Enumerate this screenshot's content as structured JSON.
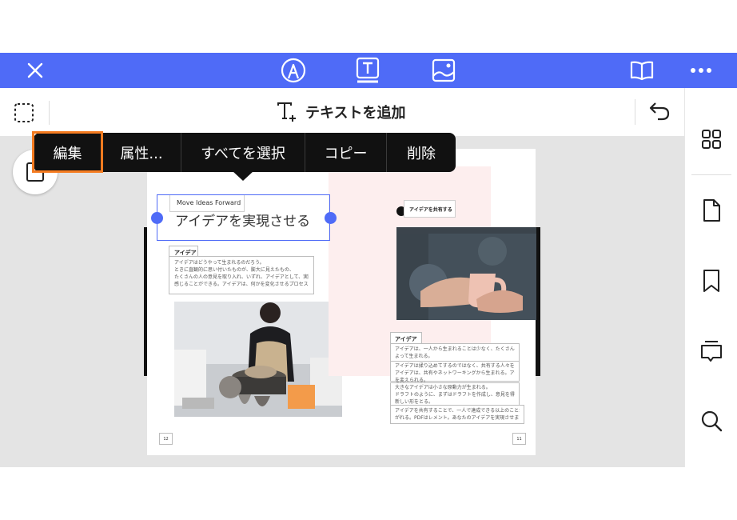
{
  "topbar": {
    "icons": [
      "close-icon",
      "pen-icon",
      "text-icon",
      "image-icon",
      "book-icon",
      "more-icon"
    ]
  },
  "toolbar": {
    "add_text_label": "テキストを追加"
  },
  "context_menu": {
    "items": [
      "編集",
      "属性...",
      "すべてを選択",
      "コピー",
      "削除"
    ]
  },
  "document": {
    "left_page": {
      "tag": "Move Ideas Forward",
      "title": "アイデアを実現させる",
      "section_heading": "アイデア",
      "body_lines": [
        "アイデアはどうやって生まれるのだろう。",
        "ときに直観的に思い付いたものが、膨大に見えたもの、",
        "たくさんの人の意見を取り入れ、いずれ、アイデアとして、実際に",
        "感じることができる。アイデアは、何かを変化させるプロセス。"
      ],
      "page_number": "12"
    },
    "right_page": {
      "badge": "アイデアを共有する",
      "section_heading": "アイデア",
      "body_lines": [
        "アイデアは、一人から生まれることは少なく、たくさんの共有の場を",
        "よって生まれる。",
        "アイデアは揉り込めてするのではなく、共有する人々を通じて、",
        "アイデアは、共有やネットワーキングから生まれる。アイデアは現実",
        "を変えられる。",
        "大きなアイデアは小さな原動力が生まれる。",
        "ドラフトのように、まずはドラフトを作成し、意見を得る。そしてまた、",
        "新しい形をとる。",
        "アイデアを共有することで、一人で達成できる以上のことが実現します。",
        "がれる。PDFはレメント。あなたのアイデアを実現させます。"
      ],
      "page_number": "11"
    }
  },
  "rightbar": {
    "icons": [
      "grid-icon",
      "page-icon",
      "bookmark-icon",
      "comment-icon",
      "search-icon"
    ]
  },
  "colors": {
    "accent": "#4f6bf7",
    "highlight": "#f47b20",
    "menu_bg": "#111111"
  }
}
